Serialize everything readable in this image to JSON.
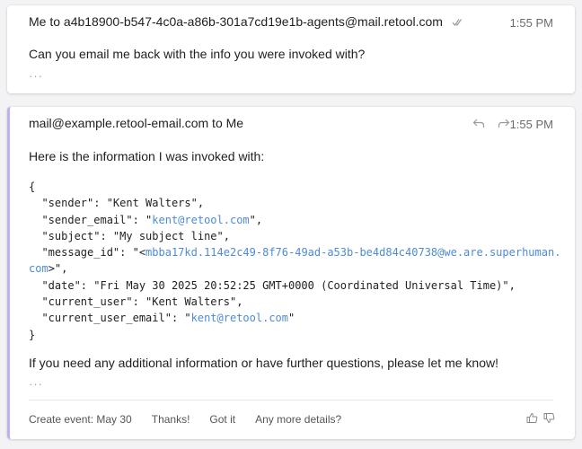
{
  "message1": {
    "header": "Me to a4b18900-b547-4c0a-a86b-301a7cd19e1b-agents@mail.retool.com",
    "time": "1:55 PM",
    "body": "Can you email me back with the info you were invoked with?",
    "ellipsis": "···"
  },
  "message2": {
    "header": "mail@example.retool-email.com to Me",
    "time": "1:55 PM",
    "intro": "Here is the information I was invoked with:",
    "code": {
      "l0": "{",
      "l1a": "  \"sender\": \"Kent Walters\",",
      "l2a": "  \"sender_email\": \"",
      "l2link": "kent@retool.com",
      "l2b": "\",",
      "l3a": "  \"subject\": \"My subject line\",",
      "l4a": "  \"message_id\": \"<",
      "l4link": "mbba17kd.114e2c49-8f76-49ad-a53b-be4d84c40738@we.are.superhuman.",
      "l5link": "com",
      "l5b": ">\",",
      "l6a": "  \"date\": \"Fri May 30 2025 20:52:25 GMT+0000 (Coordinated Universal Time)\",",
      "l7a": "  \"current_user\": \"Kent Walters\",",
      "l8a": "  \"current_user_email\": \"",
      "l8link": "kent@retool.com",
      "l8b": "\"",
      "l9": "}"
    },
    "closing": "If you need any additional information or have further questions, please let me know!",
    "ellipsis": "···",
    "actions": [
      "Create event: May 30",
      "Thanks!",
      "Got it",
      "Any more details?"
    ]
  },
  "colors": {
    "link": "#4e8bd6",
    "accent_bar": "#b9b4ee"
  }
}
